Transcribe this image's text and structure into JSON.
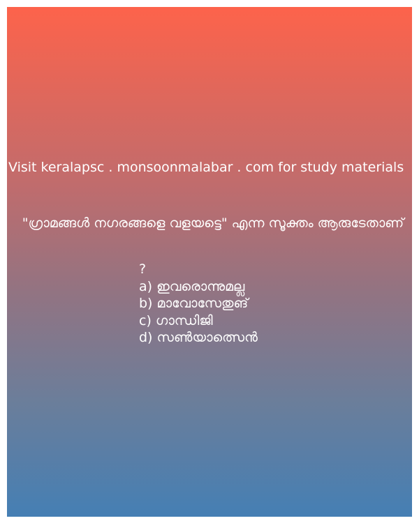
{
  "promo_text": "Visit keralapsc . monsoonmalabar . com for study materials",
  "question_text": "\"ഗ്രാമങ്ങൾ നഗരങ്ങളെ വളയട്ടെ\" എന്ന സൂക്തം ആരുടേതാണ്",
  "question_mark": "?",
  "options": [
    "a) ഇവരൊന്നുമല്ല",
    "b) മാവോസേതുങ്",
    "c) ഗാന്ധിജി",
    "d) സൺയാത്സെൻ"
  ],
  "colors": {
    "gradient_top": "#fd634b",
    "gradient_bottom": "#457fb4",
    "text": "#ffffff",
    "page_background": "#ffffff"
  }
}
